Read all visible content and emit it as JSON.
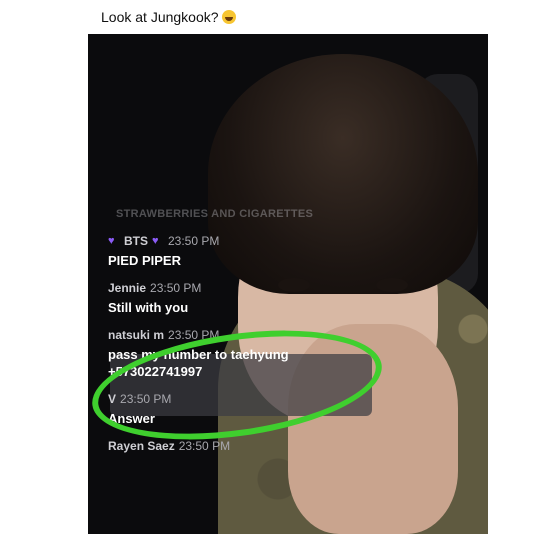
{
  "caption": "Look at Jungkook?",
  "stream_title": "STRAWBERRIES AND CIGARETTES",
  "messages": [
    {
      "name": "BTS",
      "time": "23:50 PM",
      "text": "PIED PIPER"
    },
    {
      "name": "Jennie",
      "time": "23:50 PM",
      "text": "Still with you"
    },
    {
      "name": "natsuki m",
      "time": "23:50 PM",
      "text": "pass my number to taehyung\n+573022741997"
    },
    {
      "name": "V",
      "time": "23:50 PM",
      "text": "Answer"
    },
    {
      "name": "Rayen Saez",
      "time": "23:50 PM",
      "text": ""
    }
  ],
  "colors": {
    "highlight": "#3fcf2e",
    "heart": "#8b5cf6"
  }
}
